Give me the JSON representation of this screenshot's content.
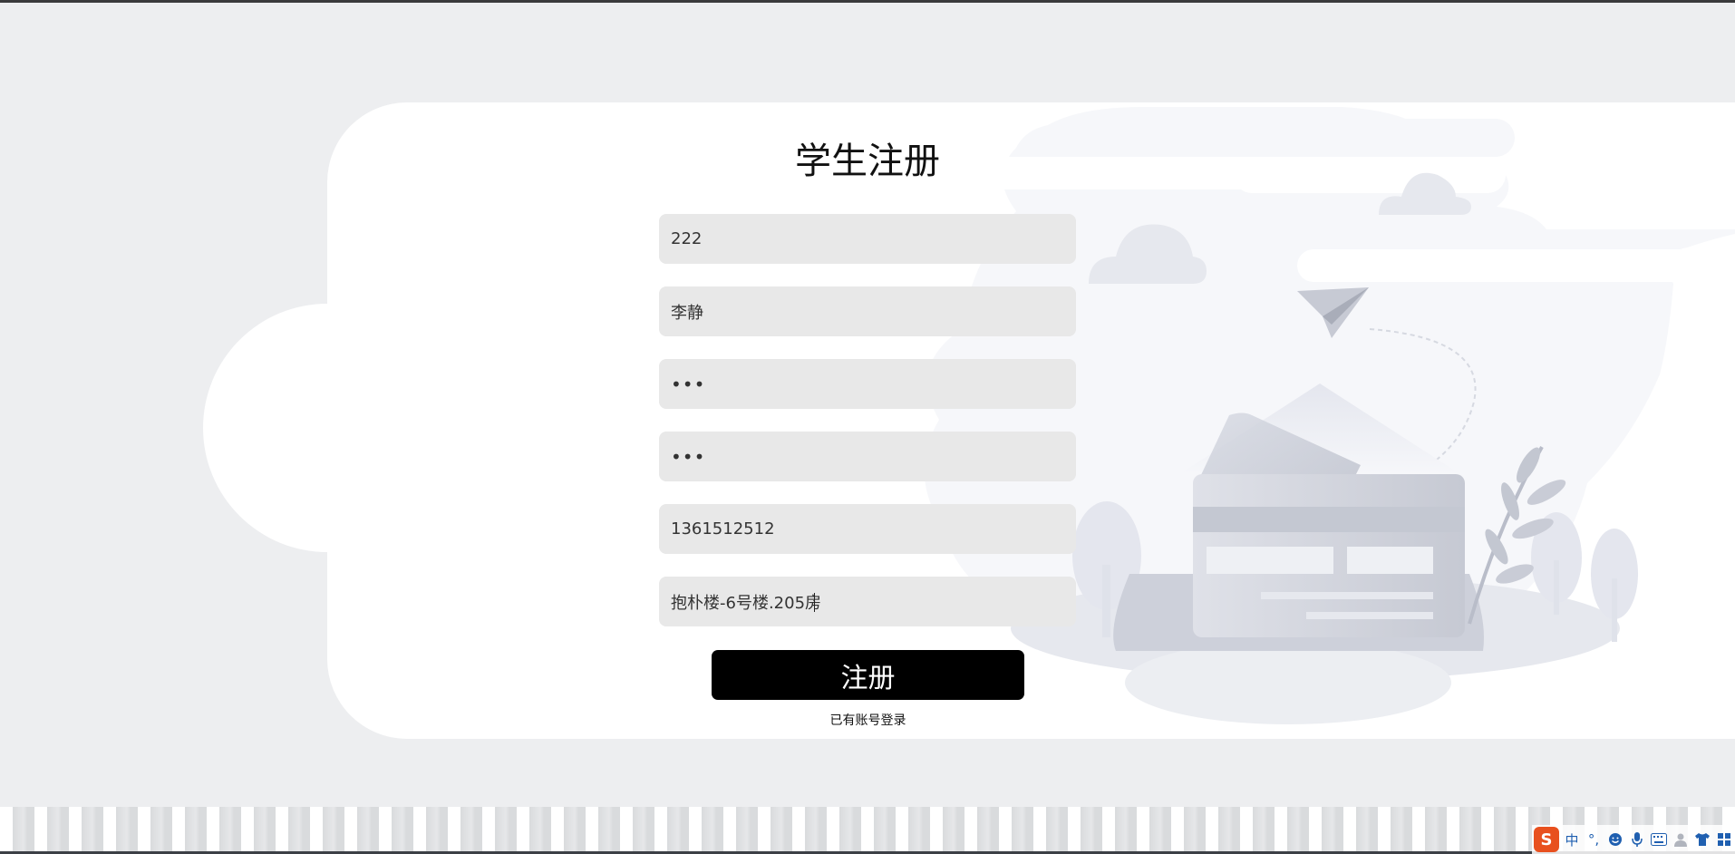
{
  "page": {
    "title": "学生注册"
  },
  "form": {
    "fields": [
      {
        "name": "student-id",
        "value": "222"
      },
      {
        "name": "student-name",
        "value": "李静"
      },
      {
        "name": "password",
        "value": "•••"
      },
      {
        "name": "confirm-password",
        "value": "•••"
      },
      {
        "name": "phone",
        "value": "1361512512"
      },
      {
        "name": "dorm-address",
        "value": "抱朴楼-6号楼.205房"
      }
    ],
    "submit_label": "注册",
    "login_link": "已有账号登录"
  },
  "ime_toolbar": {
    "logo": "S",
    "mode": "中",
    "punct": "°,",
    "icons": [
      "emoji-icon",
      "microphone-icon",
      "keyboard-icon",
      "user-icon",
      "skin-icon",
      "grid-icon"
    ]
  },
  "colors": {
    "background": "#edeef0",
    "card": "#ffffff",
    "field_bg": "#e8e8e8",
    "button": "#000000",
    "ime_logo": "#e8501e",
    "ime_accent": "#1f5fb0"
  }
}
